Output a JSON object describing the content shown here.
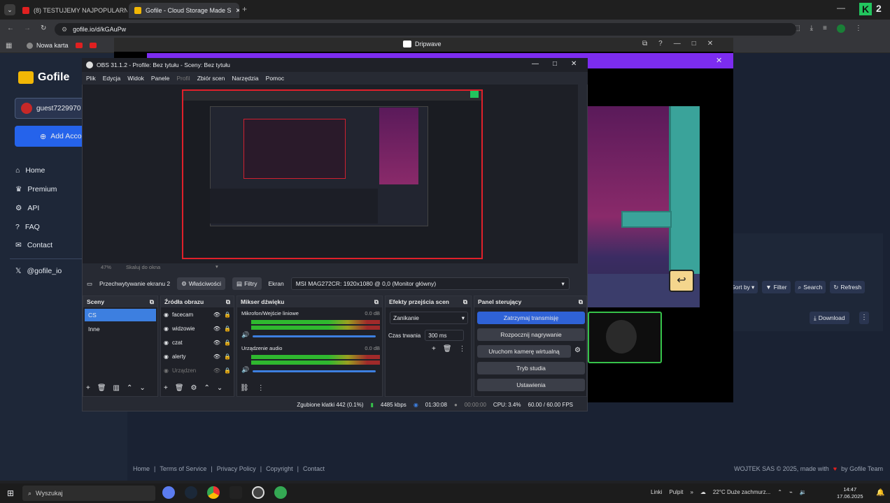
{
  "chrome": {
    "tabs": [
      {
        "title": "(8) TESTUJEMY NAJPOPULARN",
        "favicon_color": "#e02020"
      },
      {
        "title": "Gofile - Cloud Storage Made S",
        "favicon_color": "#f2b705"
      }
    ],
    "url": "gofile.io/d/kGAuPw",
    "bookmarks": [
      {
        "label": "Nowa karta"
      }
    ]
  },
  "gofile": {
    "brand": "Gofile",
    "user": "guest7229970",
    "add_account": "Add Acco",
    "nav": [
      "Home",
      "Premium",
      "API",
      "FAQ",
      "Contact"
    ],
    "social": "@gofile_io",
    "toolbar": {
      "sort": "Sort by",
      "filter": "Filter",
      "search": "Search",
      "refresh": "Refresh"
    },
    "download": "Download",
    "footer": {
      "links": [
        "Home",
        "Terms of Service",
        "Privacy Policy",
        "Copyright",
        "Contact"
      ],
      "copyright": "WOJTEK SAS © 2025, made with",
      "by": "by Gofile Team"
    }
  },
  "popup": {
    "title": "Dripwave"
  },
  "obs": {
    "title": "OBS 31.1.2 - Profile: Bez tytułu - Sceny: Bez tytułu",
    "menu": [
      "Plik",
      "Edycja",
      "Widok",
      "Panele",
      "Profil",
      "Zbiór scen",
      "Narzędzia",
      "Pomoc"
    ],
    "zoom": "47%",
    "scale": "Skaluj do okna",
    "source_bar": {
      "source": "Przechwytywanie ekranu 2",
      "properties": "Właściwości",
      "filters": "Filtry",
      "screen_label": "Ekran",
      "screen_value": "MSI MAG272CR: 1920x1080 @ 0,0 (Monitor główny)"
    },
    "scenes": {
      "title": "Sceny",
      "items": [
        "CS",
        "Inne"
      ]
    },
    "sources": {
      "title": "Źródła obrazu",
      "items": [
        "facecam",
        "widzowie",
        "czat",
        "alerty",
        "Urządzen"
      ]
    },
    "mixer": {
      "title": "Mikser dźwięku",
      "channels": [
        {
          "name": "Mikrofon/Wejście liniowe",
          "db": "0.0 dB"
        },
        {
          "name": "Urządzenie audio",
          "db": "0.0 dB"
        }
      ]
    },
    "transitions": {
      "title": "Efekty przejścia scen",
      "type": "Zanikanie",
      "duration_label": "Czas trwania",
      "duration": "300 ms"
    },
    "controls": {
      "title": "Panel sterujący",
      "buttons": [
        "Zatrzymaj transmisję",
        "Rozpocznij nagrywanie",
        "Uruchom kamerę wirtualną",
        "Tryb studia",
        "Ustawienia"
      ]
    },
    "status": {
      "dropped": "Zgubione klatki 442 (0.1%)",
      "bitrate": "4485 kbps",
      "stream_time": "01:30:08",
      "rec_time": "00:00:00",
      "cpu": "CPU: 3.4%",
      "fps": "60.00 / 60.00 FPS"
    }
  },
  "taskbar": {
    "search": "Wyszukaj",
    "tray": {
      "links": "Linki",
      "pulpit": "Pulpit",
      "weather": "22°C Duże zachmurz...",
      "time": "14:47",
      "date": "17.06.2025"
    }
  },
  "colors": {
    "accent": "#3d7fe0",
    "obs_red": "#e0202a",
    "purple": "#7c2cf0",
    "gofile_blue": "#2563eb"
  }
}
